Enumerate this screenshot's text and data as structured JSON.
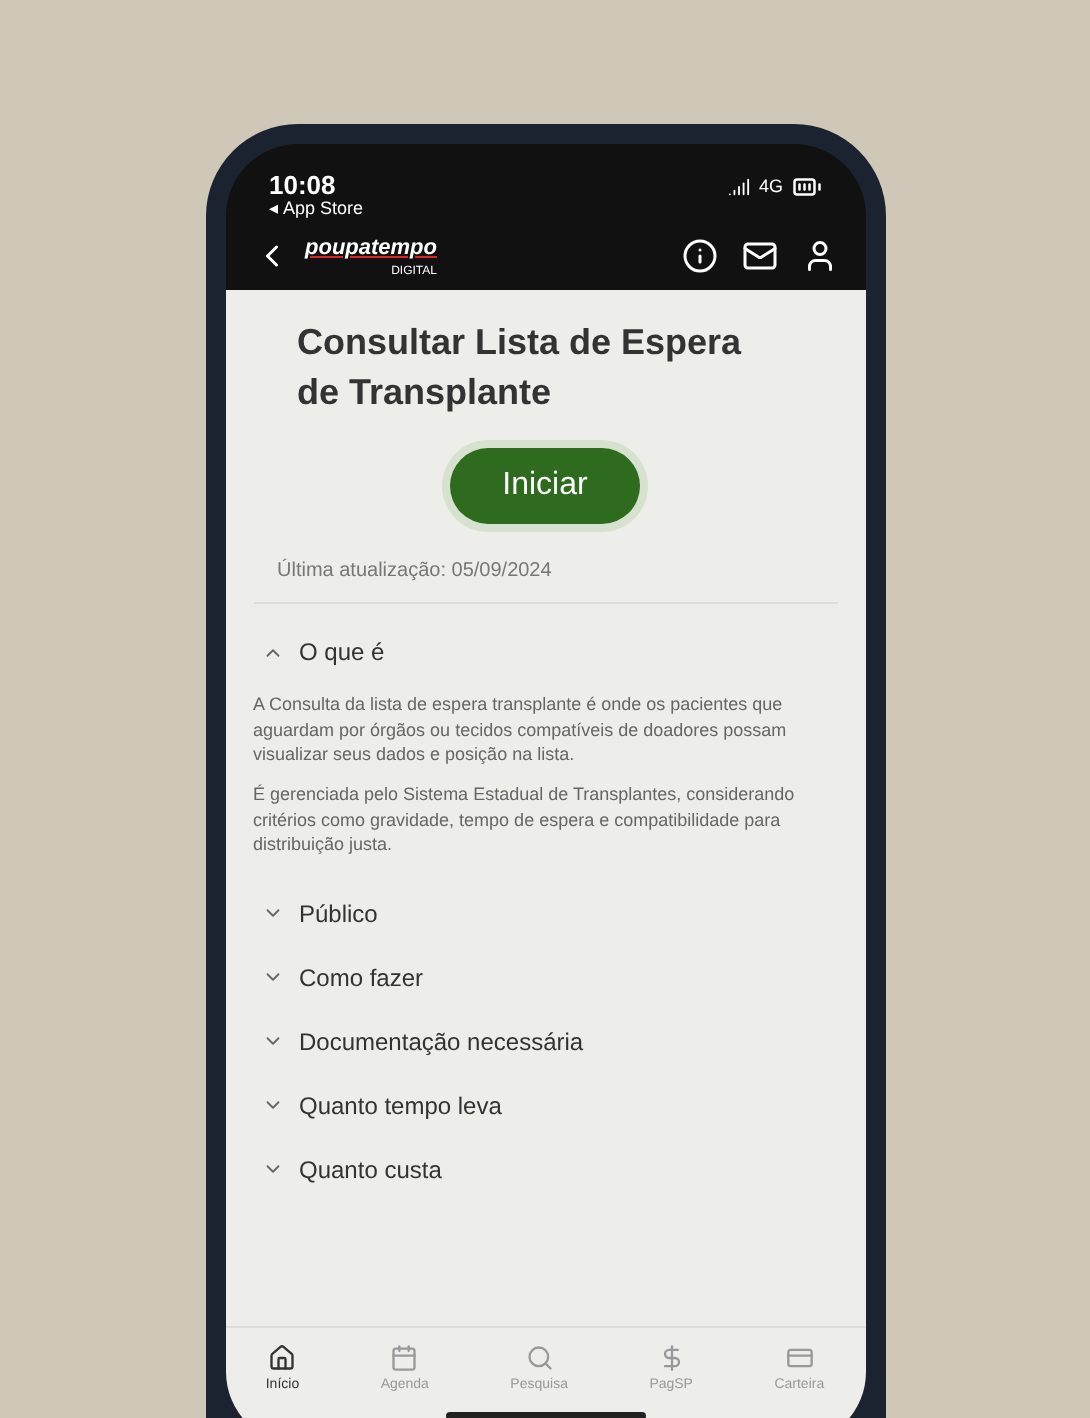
{
  "status_bar": {
    "time": "10:08",
    "back_app": "◂ App Store",
    "network": "4G"
  },
  "header": {
    "logo_title": "poupatempo",
    "logo_subtitle": "DIGITAL"
  },
  "page": {
    "title": "Consultar Lista de Espera de Transplante",
    "start_button": "Iniciar",
    "updated": "Última atualização: 05/09/2024"
  },
  "sections": [
    {
      "title": "O que é",
      "expanded": true,
      "paragraphs": [
        "A Consulta da lista de espera transplante é onde os pacientes que aguardam por órgãos ou tecidos compatíveis de doadores possam visualizar seus dados e posição na lista.",
        "É gerenciada pelo Sistema Estadual de Transplantes, considerando critérios como gravidade, tempo de espera e compatibilidade para distribuição justa."
      ]
    },
    {
      "title": "Público",
      "expanded": false
    },
    {
      "title": "Como fazer",
      "expanded": false
    },
    {
      "title": "Documentação necessária",
      "expanded": false
    },
    {
      "title": "Quanto tempo leva",
      "expanded": false
    },
    {
      "title": "Quanto custa",
      "expanded": false
    }
  ],
  "tab_bar": [
    {
      "label": "Início",
      "selected": true
    },
    {
      "label": "Agenda",
      "selected": false
    },
    {
      "label": "Pesquisa",
      "selected": false
    },
    {
      "label": "PagSP",
      "selected": false
    },
    {
      "label": "Carteira",
      "selected": false
    }
  ]
}
